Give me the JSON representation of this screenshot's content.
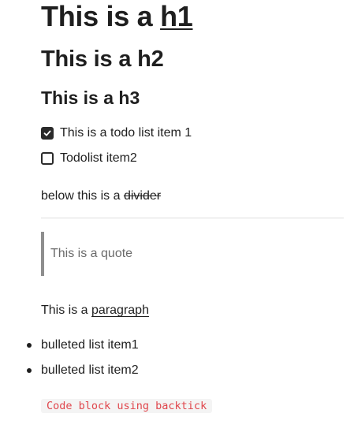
{
  "h1": {
    "prefix": "This is a ",
    "link": "h1"
  },
  "h2": {
    "text": "This is a h2"
  },
  "h3": {
    "text": "This is a h3"
  },
  "todos": [
    {
      "label": "This is a todo list item 1",
      "checked": true
    },
    {
      "label": "Todolist item2",
      "checked": false
    }
  ],
  "divider_line": {
    "prefix": "below this is a ",
    "struck": "divider"
  },
  "quote": {
    "text": "This is a quote"
  },
  "paragraph": {
    "prefix": "This is a ",
    "link": "paragraph"
  },
  "bullets": [
    "bulleted list item1",
    "bulleted list item2"
  ],
  "code": {
    "text": "Code block using backtick"
  },
  "colors": {
    "text": "#1f1f1f",
    "quote_bar": "#8e8e8e",
    "code_text": "#e0464c",
    "code_bg": "#f4f4f4",
    "divider": "#dedede"
  }
}
